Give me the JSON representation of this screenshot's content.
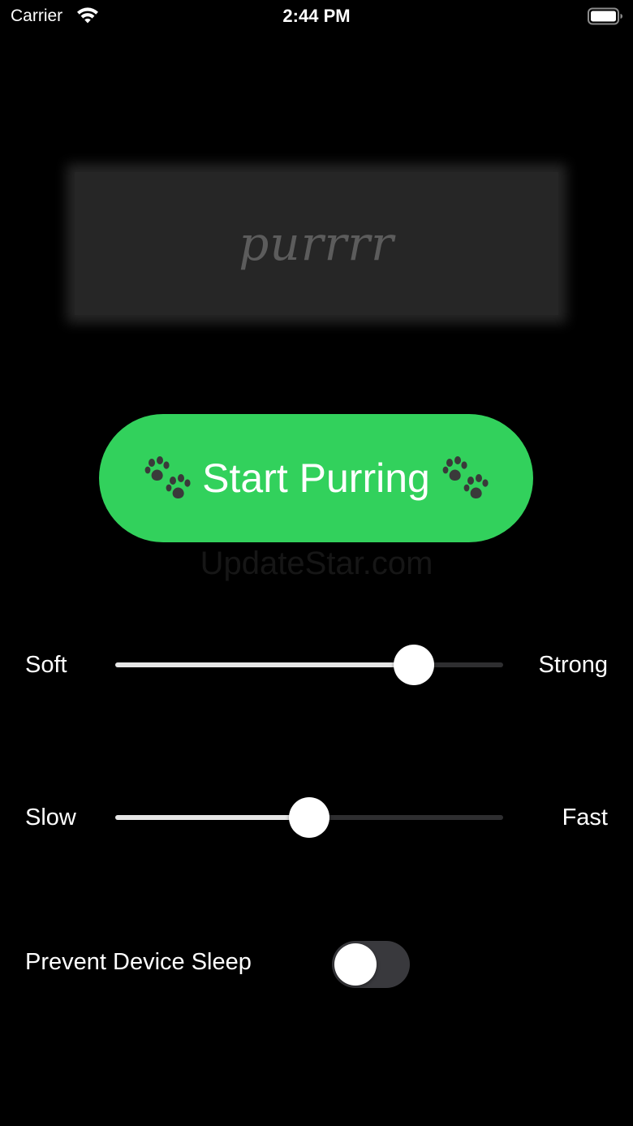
{
  "status_bar": {
    "carrier": "Carrier",
    "time": "2:44 PM",
    "wifi_icon": "wifi-icon",
    "battery_icon": "battery-full-icon"
  },
  "display": {
    "text": "purrrr"
  },
  "start_button": {
    "label": "Start Purring",
    "icon": "paw-prints-icon",
    "color": "#32d15c"
  },
  "watermark": "UpdateStar.com",
  "intensity_slider": {
    "min_label": "Soft",
    "max_label": "Strong",
    "value": 0.77
  },
  "speed_slider": {
    "min_label": "Slow",
    "max_label": "Fast",
    "value": 0.5
  },
  "prevent_sleep": {
    "label": "Prevent Device Sleep",
    "on": false
  },
  "colors": {
    "background": "#000000",
    "accent": "#32d15c",
    "display_box": "#262626",
    "track_fill": "#e6e6e6",
    "track_empty": "#2e2e30",
    "toggle_off": "#39393d"
  }
}
